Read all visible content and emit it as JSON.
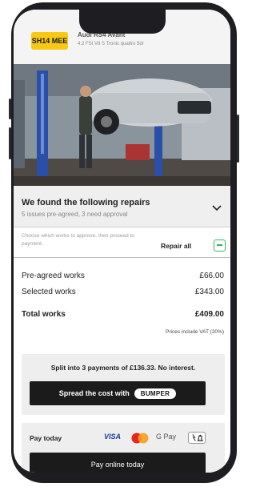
{
  "vehicle": {
    "plate": "SH14 MEE",
    "name": "Audi RS4 Avant",
    "spec": "4.2 FSI V8 S Tronic quattro 5dr"
  },
  "repairs": {
    "title": "We found the following repairs",
    "subtitle": "5 issues pre-agreed, 3 need approval",
    "choose_text": "Choose which works to approve, then proceed to payment.",
    "repair_all_label": "Repair all"
  },
  "summary": {
    "rows": [
      {
        "label": "Pre-agreed works",
        "value": "£66.00"
      },
      {
        "label": "Selected works",
        "value": "£343.00"
      }
    ],
    "total_label": "Total works",
    "total_value": "£409.00",
    "vat_note": "Prices include VAT (20%)"
  },
  "split": {
    "text": "Split into 3 payments of £136.33. No interest.",
    "button_label": "Spread the cost with",
    "brand": "BUMPER"
  },
  "payment": {
    "label": "Pay today",
    "methods": [
      "VISA",
      "G Pay"
    ],
    "button_label": "Pay online today"
  },
  "colors": {
    "plate": "#f7c814",
    "toggle": "#35b45a",
    "button": "#1b1b1b"
  }
}
